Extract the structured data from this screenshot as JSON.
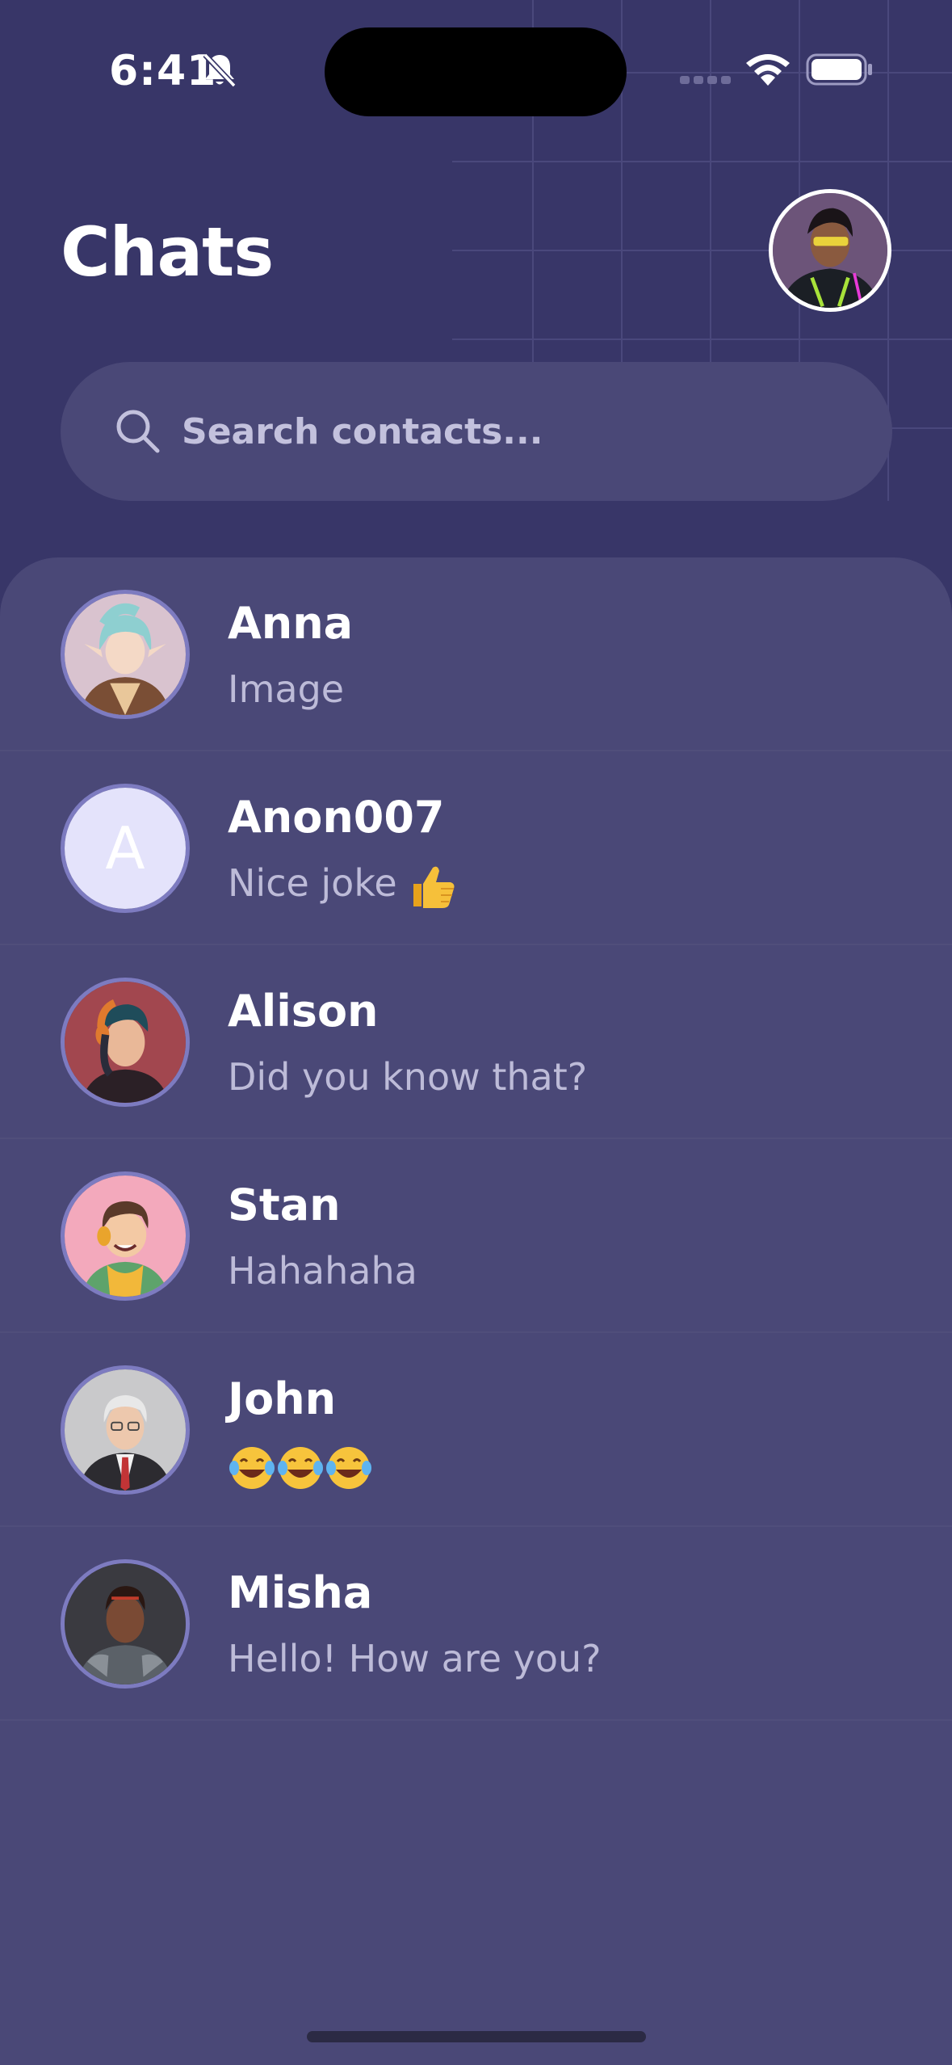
{
  "status_bar": {
    "time": "6:41",
    "icons": [
      "bell-off-icon",
      "signal-icon",
      "wifi-icon",
      "battery-icon"
    ]
  },
  "header": {
    "title": "Chats",
    "profile_avatar": "profile-avatar"
  },
  "search": {
    "placeholder": "Search contacts...",
    "value": ""
  },
  "chats": [
    {
      "name": "Anna",
      "preview": "Image",
      "avatar": "anna-avatar"
    },
    {
      "name": "Anon007",
      "preview": "Nice joke",
      "preview_emoji": "thumbs-up-icon",
      "avatar_letter": "A"
    },
    {
      "name": "Alison",
      "preview": "Did you know that?",
      "avatar": "alison-avatar"
    },
    {
      "name": "Stan",
      "preview": "Hahahaha",
      "avatar": "stan-avatar"
    },
    {
      "name": "John",
      "preview_emoji": "laughing-tears-icon x3",
      "avatar": "john-avatar"
    },
    {
      "name": "Misha",
      "preview": "Hello! How are you?",
      "avatar": "misha-avatar"
    }
  ],
  "colors": {
    "background": "#383668",
    "panel": "#4a4877",
    "avatar_ring": "#7d7bc0",
    "preview_text": "#bdbbd8"
  }
}
